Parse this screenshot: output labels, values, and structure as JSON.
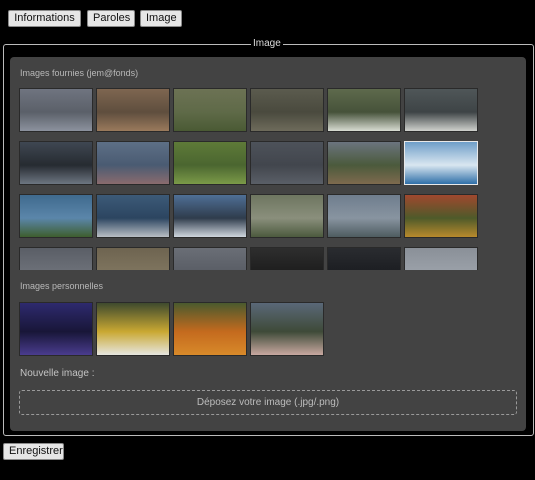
{
  "tabs": [
    {
      "id": "tab-informations",
      "label": "Informations"
    },
    {
      "id": "tab-paroles",
      "label": "Paroles"
    },
    {
      "id": "tab-image",
      "label": "Image"
    }
  ],
  "fieldset": {
    "legend": "Image"
  },
  "provided": {
    "label": "Images fournies (jem@fonds)",
    "images": [
      {
        "name": "frosted-branches-thumbnail",
        "colors": [
          "#6f7480",
          "#8c929e",
          "#5b6069"
        ],
        "selected": false
      },
      {
        "name": "autumn-leaves-thumbnail",
        "colors": [
          "#7e6650",
          "#9a7a5c",
          "#5f4e3e"
        ],
        "selected": false
      },
      {
        "name": "vineyard-thumbnail",
        "colors": [
          "#6c7254",
          "#4a5a34",
          "#5f6a48"
        ],
        "selected": false
      },
      {
        "name": "grass-ground-thumbnail",
        "colors": [
          "#5b5b4e",
          "#6e6b5b",
          "#4a4a3e"
        ],
        "selected": false
      },
      {
        "name": "white-flowers-thumbnail",
        "colors": [
          "#5e6a4c",
          "#d8dcd2",
          "#46523a"
        ],
        "selected": false
      },
      {
        "name": "swan-thumbnail",
        "colors": [
          "#4f5658",
          "#cfd1cd",
          "#3e4446"
        ],
        "selected": false
      },
      {
        "name": "bare-trees-silhouette-thumbnail",
        "colors": [
          "#3f4752",
          "#6d7681",
          "#262b31"
        ],
        "selected": false
      },
      {
        "name": "cherry-blossom-branch-thumbnail",
        "colors": [
          "#5d6f86",
          "#8a6b6e",
          "#4a5b72"
        ],
        "selected": false
      },
      {
        "name": "green-rice-field-thumbnail",
        "colors": [
          "#5e7a38",
          "#7b9a48",
          "#4b6630"
        ],
        "selected": false
      },
      {
        "name": "grey-texture-thumbnail",
        "colors": [
          "#4d525a",
          "#5a5f67",
          "#42464d"
        ],
        "selected": false
      },
      {
        "name": "autumn-tree-field-thumbnail",
        "colors": [
          "#6b747e",
          "#7e6a4e",
          "#4b5a3c"
        ],
        "selected": false
      },
      {
        "name": "boat-wake-sea-thumbnail",
        "colors": [
          "#6e9ec8",
          "#2f6fa8",
          "#d9e6f0"
        ],
        "selected": true
      },
      {
        "name": "treetops-sky-thumbnail",
        "colors": [
          "#3f6a8e",
          "#3e5e2e",
          "#5b86aa"
        ],
        "selected": false
      },
      {
        "name": "cloudy-sky-thumbnail",
        "colors": [
          "#3c5a78",
          "#b9bec4",
          "#2c4560"
        ],
        "selected": false
      },
      {
        "name": "snowy-mountain-thumbnail",
        "colors": [
          "#4f6f96",
          "#cfd6de",
          "#2f3c4c"
        ],
        "selected": false
      },
      {
        "name": "birch-forest-thumbnail",
        "colors": [
          "#6e7660",
          "#4c5a3e",
          "#8a8f7c"
        ],
        "selected": false
      },
      {
        "name": "mountain-valley-thumbnail",
        "colors": [
          "#6f7d8e",
          "#4e5c60",
          "#8894a0"
        ],
        "selected": false
      },
      {
        "name": "tulips-thumbnail",
        "colors": [
          "#a0482e",
          "#b88a2c",
          "#4e5a2a"
        ],
        "selected": false
      },
      {
        "name": "dark-clouds-thumbnail",
        "colors": [
          "#5a5e66",
          "#3f4248",
          "#6c7078"
        ],
        "selected": false
      },
      {
        "name": "sepia-landscape-thumbnail",
        "colors": [
          "#6e6450",
          "#5a5242",
          "#7e745e"
        ],
        "selected": false
      },
      {
        "name": "grey-sky-thumbnail",
        "colors": [
          "#6a6e76",
          "#7c8088",
          "#5a5e66"
        ],
        "selected": false
      },
      {
        "name": "dark-foliage-thumbnail",
        "colors": [
          "#2e2e2e",
          "#4a4a4a",
          "#1e1e1e"
        ],
        "selected": false
      },
      {
        "name": "dark-shore-thumbnail",
        "colors": [
          "#2a2c30",
          "#3a3e44",
          "#1c1e22"
        ],
        "selected": false
      },
      {
        "name": "pale-horizon-thumbnail",
        "colors": [
          "#8a9098",
          "#6e747c",
          "#9aa0a8"
        ],
        "selected": false
      }
    ]
  },
  "personal": {
    "label": "Images personnelles",
    "images": [
      {
        "name": "purple-night-sky-thumbnail",
        "colors": [
          "#2e2a6e",
          "#4a3c8e",
          "#181638"
        ]
      },
      {
        "name": "daisy-thumbnail",
        "colors": [
          "#3e4a2e",
          "#e6e6e0",
          "#c9a832"
        ]
      },
      {
        "name": "orange-flowers-thumbnail",
        "colors": [
          "#4a5a2e",
          "#d88a2a",
          "#c46a1e"
        ]
      },
      {
        "name": "sunset-mountain-thumbnail",
        "colors": [
          "#5a6878",
          "#c8a8a0",
          "#3e4a38"
        ]
      }
    ]
  },
  "new_image": {
    "label": "Nouvelle image :",
    "dropzone_text": "Déposez votre image (.jpg/.png)"
  },
  "save_label": "Enregistrer",
  "colors": {
    "background": "#000000",
    "panel": "#434343",
    "button": "#e6e6e6"
  }
}
